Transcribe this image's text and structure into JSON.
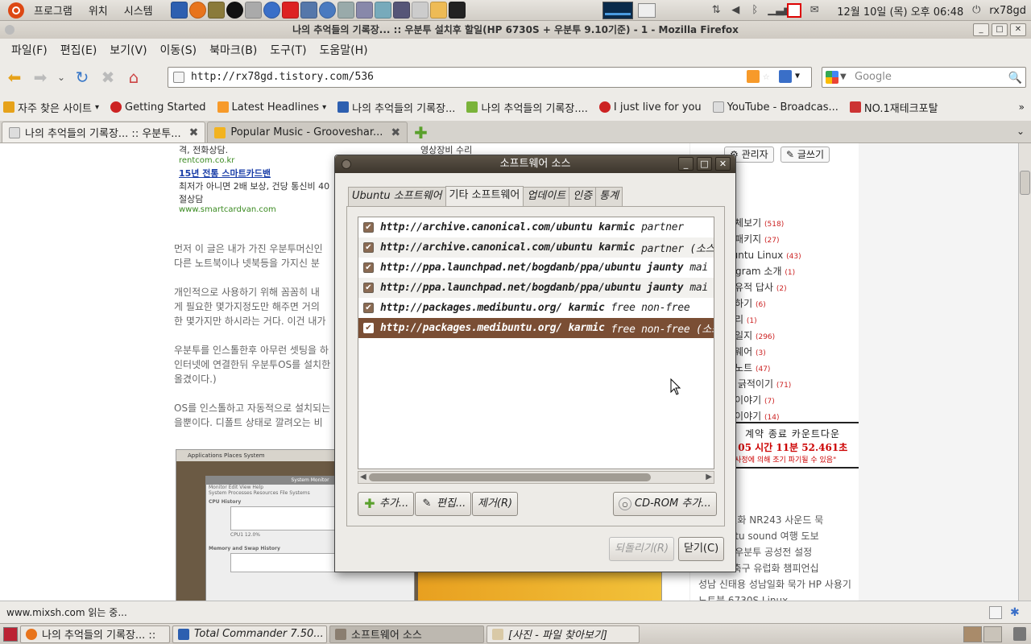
{
  "top_panel": {
    "menus": [
      "프로그램",
      "위치",
      "시스템"
    ],
    "clock": "12월 10일 (목) 오후 06:48",
    "user": "rx78gd"
  },
  "firefox": {
    "title": "나의 추억들의 기록장... :: 우분투 설치후 할일(HP 6730S + 우분투 9.10기준) - 1 - Mozilla Firefox",
    "menu": [
      "파일(F)",
      "편집(E)",
      "보기(V)",
      "이동(S)",
      "북마크(B)",
      "도구(T)",
      "도움말(H)"
    ],
    "url": "http://rx78gd.tistory.com/536",
    "search_placeholder": "Google",
    "bookmarks": [
      "자주 찾은 사이트",
      "Getting Started",
      "Latest Headlines",
      "나의 추억들의 기록장...",
      "나의 추억들의 기록장....",
      "I just live for you",
      "YouTube - Broadcas...",
      "NO.1재테크포탈"
    ],
    "tabs": [
      {
        "label": "나의 추억들의 기록장... :: 우분투...",
        "active": true
      },
      {
        "label": "Popular Music - Grooveshar...",
        "active": false
      }
    ],
    "status": "www.mixsh.com 읽는 중..."
  },
  "page": {
    "ad_top_line": "격, 전화상담.",
    "ad_top_url": "rentcom.co.kr",
    "ad_mid_text": "영상장비 수리",
    "ad2_title": "15년 전통 스마트카드밴",
    "ad2_body": "최저가 아니면 2배 보상, 건당 통신비 40",
    "ad2_body2": "절상담",
    "ad2_url": "www.smartcardvan.com",
    "paragraphs": [
      [
        "먼저 이 글은 내가 가진 우분투머신인",
        "다른 노트북이나 넷북등을 가지신 분"
      ],
      [
        "개인적으로 사용하기 위해 꼼꼼히 내",
        "게 필요한 몇가지정도만 해주면 거의",
        "한 몇가지만 하시라는 거다. 이건 내가"
      ],
      [
        "우분투를 인스톨한후 아무런 셋팅을 하",
        "인터넷에 연결한뒤 우분투OS를 설치한",
        "올겼이다.)"
      ],
      [
        "OS를 인스톨하고 자동적으로 설치되는",
        "을뿐이다. 디폴트 상태로 깔려오는 비"
      ]
    ],
    "admin_button": "관리자",
    "write_button": "글쓰기",
    "categories": [
      {
        "name": "전체보기",
        "count": "(518)"
      },
      {
        "name": "임패키지",
        "count": "(27)"
      },
      {
        "name": "buntu Linux",
        "count": "(43)"
      },
      {
        "name": "rogram 소개",
        "count": "(1)"
      },
      {
        "name": "화유적 답사",
        "count": "(2)"
      },
      {
        "name": "행하기",
        "count": "(6)"
      },
      {
        "name": "거리",
        "count": "(1)"
      },
      {
        "name": "련일지",
        "count": "(296)"
      },
      {
        "name": "드웨어",
        "count": "(3)"
      },
      {
        "name": "서노트",
        "count": "(47)"
      },
      {
        "name": "자 긁적이기",
        "count": "(71)"
      },
      {
        "name": "임이야기",
        "count": "(7)"
      },
      {
        "name": "화이야기",
        "count": "(14)"
      }
    ],
    "countdown_title": "계약 종료 카운트다운",
    "countdown_line": "일 05 시간 11분 52.461초",
    "countdown_note": "는 사정에 의해 조기 파기될 수 있음\"",
    "tag_lines": [
      "0 리뷰 일화 NR243 사운드 묵",
      "스 ubuntu sound 여행 도보",
      "0 K리그 우분투 공성전 설정",
      "X1000 축구 유럽화 챔피언십",
      "성남 신태용 성남일화 묵가 HP 사용기",
      "노트북 6730S Linux"
    ],
    "embedded_screenshot": {
      "menu": "Applications  Places  System",
      "window_title": "System Monitor",
      "sysmon_menu": "Monitor  Edit  View  Help",
      "sysmon_tabs": "System  Processes  Resources  File Systems",
      "cpu_label": "CPU History",
      "cpu_value": "CPU1  12.0%",
      "mem_label": "Memory and Swap History"
    }
  },
  "dialog": {
    "title": "소프트웨어 소스",
    "tabs": [
      "Ubuntu 소프트웨어",
      "기타 소프트웨어",
      "업데이트",
      "인증",
      "통계"
    ],
    "selected_tab": 1,
    "sources": [
      {
        "uri": "http://archive.canonical.com/ubuntu karmic",
        "components": "partner",
        "checked": true
      },
      {
        "uri": "http://archive.canonical.com/ubuntu karmic",
        "components": "partner (소스",
        "checked": true
      },
      {
        "uri": "http://ppa.launchpad.net/bogdanb/ppa/ubuntu jaunty",
        "components": "mai",
        "checked": true
      },
      {
        "uri": "http://ppa.launchpad.net/bogdanb/ppa/ubuntu jaunty",
        "components": "mai",
        "checked": true
      },
      {
        "uri": "http://packages.medibuntu.org/ karmic",
        "components": "free non-free",
        "checked": true
      },
      {
        "uri": "http://packages.medibuntu.org/ karmic",
        "components": "free non-free (소스",
        "checked": true,
        "selected": true
      }
    ],
    "buttons": {
      "add": "추가...",
      "edit": "편집...",
      "remove": "제거(R)",
      "cdrom": "CD-ROM 추가...",
      "revert": "되돌리기(R)",
      "close": "닫기(C)"
    }
  },
  "taskbar": {
    "tasks": [
      {
        "label": "나의 추억들의 기록장... ::",
        "active": false
      },
      {
        "label": "Total Commander 7.50...",
        "active": false
      },
      {
        "label": "소프트웨어 소스",
        "active": true
      },
      {
        "label": "[사진 - 파일 찾아보기]",
        "active": false
      }
    ]
  }
}
